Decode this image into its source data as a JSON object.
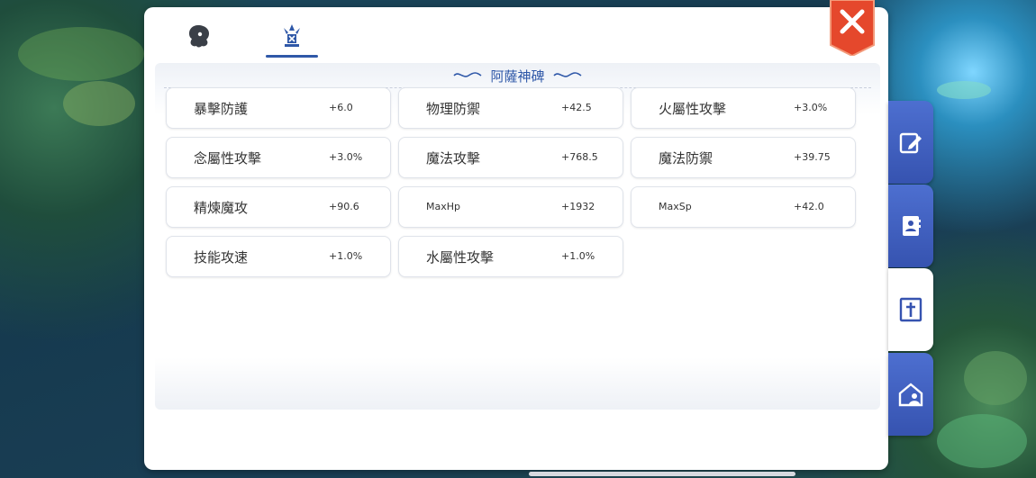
{
  "tabs": [
    {
      "icon": "head-silhouette-icon"
    },
    {
      "icon": "monument-icon",
      "active": true
    }
  ],
  "section": {
    "title": "阿薩神碑"
  },
  "stats": [
    {
      "name": "暴擊防護",
      "value": "+6.0"
    },
    {
      "name": "物理防禦",
      "value": "+42.5"
    },
    {
      "name": "火屬性攻擊",
      "value": "+3.0%"
    },
    {
      "name": "念屬性攻擊",
      "value": "+3.0%"
    },
    {
      "name": "魔法攻擊",
      "value": "+768.5"
    },
    {
      "name": "魔法防禦",
      "value": "+39.75"
    },
    {
      "name": "精煉魔攻",
      "value": "+90.6"
    },
    {
      "name": "MaxHp",
      "value": "+1932"
    },
    {
      "name": "MaxSp",
      "value": "+42.0"
    },
    {
      "name": "技能攻速",
      "value": "+1.0%"
    },
    {
      "name": "水屬性攻擊",
      "value": "+1.0%"
    }
  ],
  "side_tabs": [
    {
      "icon": "edit-note-icon"
    },
    {
      "icon": "contact-book-icon"
    },
    {
      "icon": "cross-monument-icon",
      "active": true
    },
    {
      "icon": "guild-house-icon"
    }
  ],
  "colors": {
    "accent": "#2f58a8",
    "close": "#e5482c",
    "side_tab": "#3f5fc0"
  }
}
